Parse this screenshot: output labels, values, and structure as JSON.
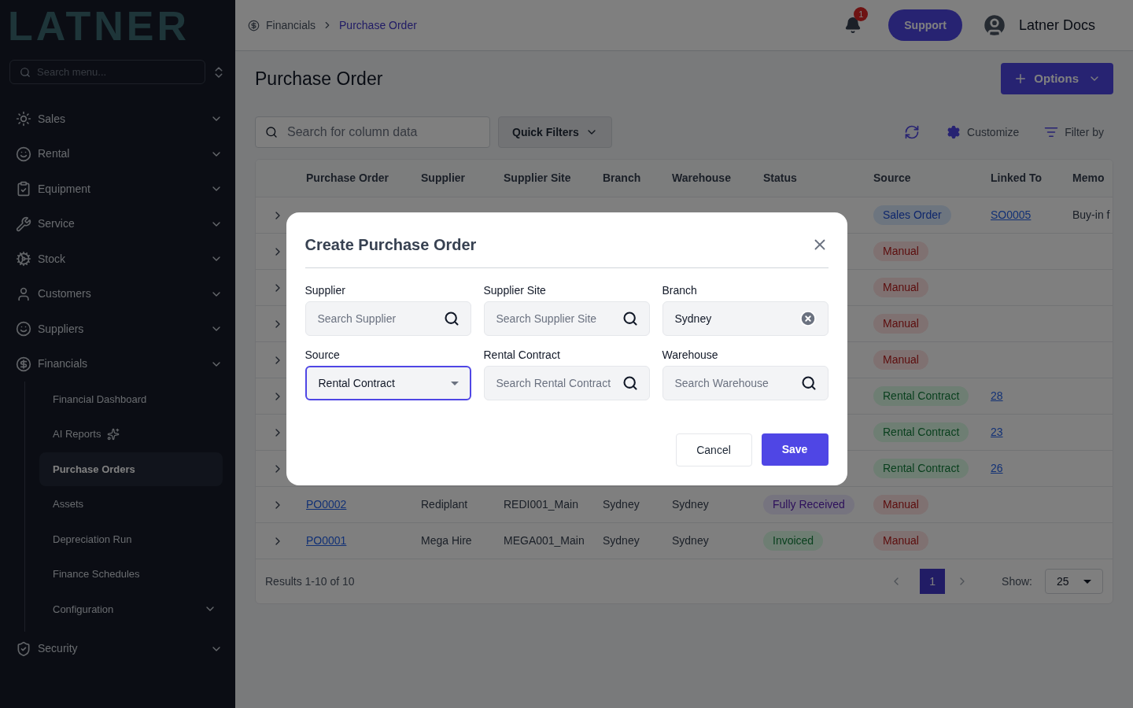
{
  "logo": "LATNER",
  "sidebar": {
    "search": {
      "placeholder": "Search menu..."
    },
    "items": [
      {
        "label": "Sales",
        "selected": false
      },
      {
        "label": "Rental",
        "selected": false
      },
      {
        "label": "Equipment",
        "selected": false
      },
      {
        "label": "Service",
        "selected": false
      },
      {
        "label": "Stock",
        "selected": false
      },
      {
        "label": "Customers",
        "selected": false
      },
      {
        "label": "Suppliers",
        "selected": false
      },
      {
        "label": "Financials",
        "selected": false,
        "children": [
          {
            "label": "Financial Dashboard",
            "selected": false
          },
          {
            "label": "AI Reports",
            "selected": false,
            "badge_icon": true
          },
          {
            "label": "Purchase Orders",
            "selected": true
          },
          {
            "label": "Assets",
            "selected": false
          },
          {
            "label": "Depreciation Run",
            "selected": false
          },
          {
            "label": "Finance Schedules",
            "selected": false
          },
          {
            "label": "Configuration",
            "selected": false,
            "has_submenu": true
          }
        ]
      },
      {
        "label": "Security",
        "selected": false
      }
    ]
  },
  "header": {
    "breadcrumb": [
      "Financials",
      "Purchase Order"
    ],
    "notifications": "1",
    "support": "Support",
    "user": "Latner Docs"
  },
  "page": {
    "title": "Purchase Order",
    "options_button": "Options"
  },
  "toolbar": {
    "search": {
      "placeholder": "Search for column data"
    },
    "quick_filters": "Quick Filters",
    "customize": "Customize",
    "filter_by": "Filter by"
  },
  "table": {
    "columns": [
      "Purchase Order",
      "Supplier",
      "Supplier Site",
      "Branch",
      "Warehouse",
      "Status",
      "Source",
      "Linked To",
      "Memo"
    ],
    "rows": [
      {
        "source": {
          "text": "Sales Order",
          "kind": "info"
        },
        "linked": "SO0005",
        "memo": "Buy-in f"
      },
      {
        "source": {
          "text": "Manual",
          "kind": "danger"
        }
      },
      {
        "source": {
          "text": "Manual",
          "kind": "danger"
        }
      },
      {
        "source": {
          "text": "Manual",
          "kind": "danger"
        }
      },
      {
        "source": {
          "text": "Manual",
          "kind": "danger"
        }
      },
      {
        "source": {
          "text": "Rental Contract",
          "kind": "success"
        },
        "linked": "28"
      },
      {
        "source": {
          "text": "Rental Contract",
          "kind": "success"
        },
        "linked": "23"
      },
      {
        "source": {
          "text": "Rental Contract",
          "kind": "success"
        },
        "linked": "26"
      },
      {
        "po": "PO0002",
        "supplier": "Rediplant",
        "site": "REDI001_Main",
        "branch": "Sydney",
        "warehouse": "Sydney",
        "status": {
          "text": "Fully Received",
          "kind": "accent"
        },
        "source": {
          "text": "Manual",
          "kind": "danger"
        }
      },
      {
        "po": "PO0001",
        "supplier": "Mega Hire",
        "site": "MEGA001_Main",
        "branch": "Sydney",
        "warehouse": "Sydney",
        "status": {
          "text": "Invoiced",
          "kind": "success"
        },
        "source": {
          "text": "Manual",
          "kind": "danger"
        }
      }
    ]
  },
  "footer": {
    "results": "Results 1-10 of 10",
    "pages": [
      {
        "label": "1",
        "selected": true
      }
    ],
    "show_label": "Show:",
    "page_size": "25"
  },
  "modal": {
    "title": "Create Purchase Order",
    "fields": [
      {
        "label": "Supplier",
        "kind": "search",
        "placeholder": "Search Supplier",
        "focused": false
      },
      {
        "label": "Supplier Site",
        "kind": "search",
        "placeholder": "Search Supplier Site",
        "focused": false
      },
      {
        "label": "Branch",
        "kind": "clearable",
        "value": "Sydney",
        "focused": false
      },
      {
        "label": "Source",
        "kind": "select",
        "value": "Rental Contract",
        "focused": true
      },
      {
        "label": "Rental Contract",
        "kind": "search",
        "placeholder": "Search Rental Contract",
        "focused": false
      },
      {
        "label": "Warehouse",
        "kind": "search",
        "placeholder": "Search Warehouse",
        "focused": false
      }
    ],
    "cancel": "Cancel",
    "save": "Save"
  }
}
